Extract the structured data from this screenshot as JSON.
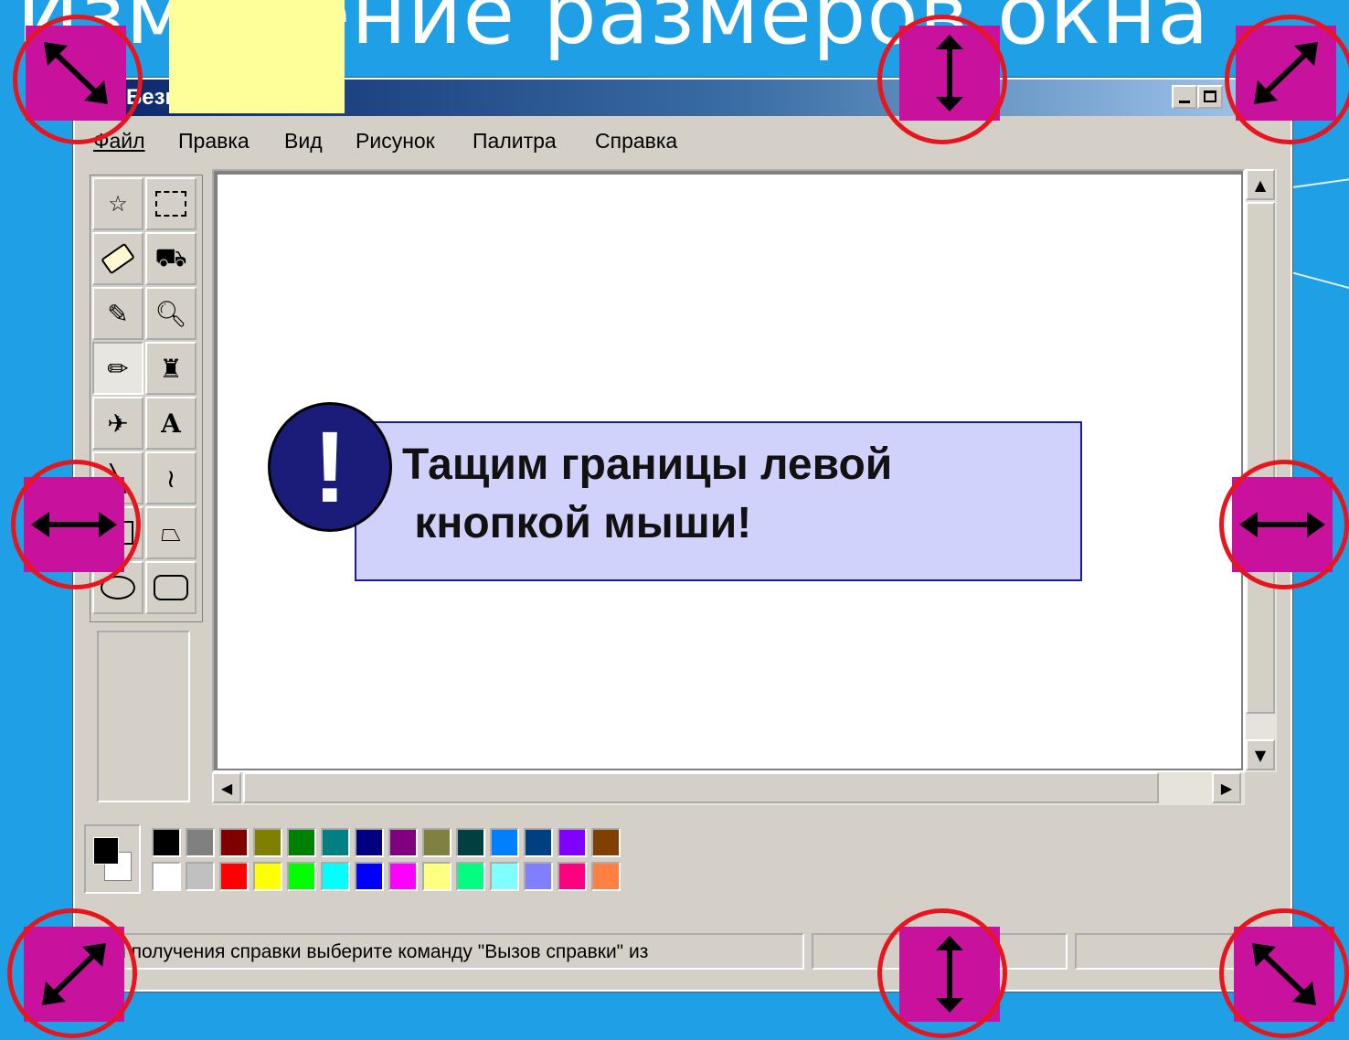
{
  "slide": {
    "title": "Изменение размеров окна"
  },
  "window": {
    "title": "Безымянный - Paint",
    "menu": [
      "Файл",
      "Правка",
      "Вид",
      "Рисунок",
      "Палитра",
      "Справка"
    ],
    "status_text": "Для получения справки выберите команду \"Вызов справки\" из"
  },
  "callout": {
    "icon": "!",
    "text": "Тащим границы левой\n кнопкой мыши!"
  },
  "tools": [
    "free-select-icon",
    "rect-select-icon",
    "eraser-icon",
    "fill-icon",
    "color-picker-icon",
    "magnifier-icon",
    "pencil-icon",
    "brush-icon",
    "airbrush-icon",
    "text-icon",
    "line-icon",
    "curve-icon",
    "rectangle-icon",
    "polygon-icon",
    "ellipse-icon",
    "rounded-rect-icon"
  ],
  "palette": {
    "top": [
      "#000000",
      "#808080",
      "#800000",
      "#808000",
      "#008000",
      "#008080",
      "#000080",
      "#800080",
      "#808040",
      "#004040",
      "#0080ff",
      "#004080",
      "#8000ff",
      "#804000"
    ],
    "bottom": [
      "#ffffff",
      "#c0c0c0",
      "#ff0000",
      "#ffff00",
      "#00ff00",
      "#00ffff",
      "#0000ff",
      "#ff00ff",
      "#ffff80",
      "#00ff80",
      "#80ffff",
      "#8080ff",
      "#ff0080",
      "#ff8040"
    ],
    "foreground": "#000000",
    "background": "#ffffff"
  },
  "colors": {
    "handle": "#c8129e",
    "ring": "#e8141e",
    "slide_bg": "#1e9fe6",
    "callout_bg": "#d1d2fb"
  }
}
